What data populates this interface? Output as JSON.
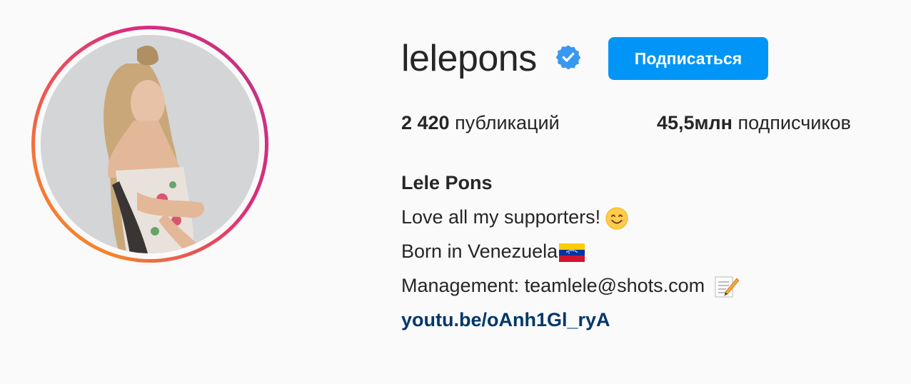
{
  "profile": {
    "username": "lelepons",
    "follow_label": "Подписаться",
    "stats": {
      "posts_count": "2 420",
      "posts_label": "публикаций",
      "followers_count": "45,5млн",
      "followers_label": "подписчиков"
    },
    "bio": {
      "full_name": "Lele Pons",
      "line1": "Love all my supporters!",
      "line2": "Born in Venezuela",
      "line3": "Management: teamlele@shots.com",
      "link": "youtu.be/oAnh1Gl_ryA"
    }
  },
  "icons": {
    "verified": "verified-badge-icon",
    "line1_emoji": "smiling-face-icon",
    "line2_emoji": "venezuela-flag-icon",
    "line3_emoji": "memo-icon"
  },
  "colors": {
    "background": "#fafafa",
    "follow_button": "#0095f6",
    "link": "#00376b",
    "verified": "#3897f0",
    "text": "#262626"
  }
}
